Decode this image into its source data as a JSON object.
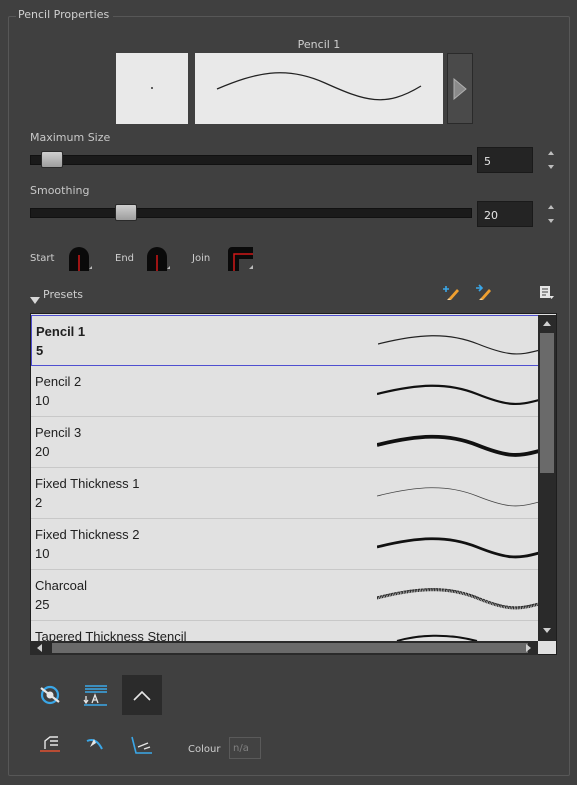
{
  "panel": {
    "title": "Pencil Properties"
  },
  "preview": {
    "brush_name": "Pencil 1"
  },
  "max_size": {
    "label": "Maximum Size",
    "value": "5",
    "level": 0.05
  },
  "smoothing": {
    "label": "Smoothing",
    "value": "20",
    "level": 0.2
  },
  "caps": {
    "start_label": "Start",
    "end_label": "End",
    "join_label": "Join"
  },
  "presets": {
    "header_label": "Presets",
    "items": [
      {
        "name": "Pencil 1",
        "size": "5",
        "selected": true
      },
      {
        "name": "Pencil 2",
        "size": "10"
      },
      {
        "name": "Pencil 3",
        "size": "20"
      },
      {
        "name": "Fixed Thickness 1",
        "size": "2"
      },
      {
        "name": "Fixed Thickness 2",
        "size": "10"
      },
      {
        "name": "Charcoal",
        "size": "25"
      },
      {
        "name": "Tapered Thickness Stencil",
        "size": ""
      }
    ]
  },
  "colour": {
    "label": "Colour",
    "value": "n/a"
  },
  "colors": {
    "accent_blue": "#3aa7e8",
    "accent_orange": "#f0a030",
    "cap_red": "#d01818",
    "selection_border": "#4f4fd0"
  }
}
